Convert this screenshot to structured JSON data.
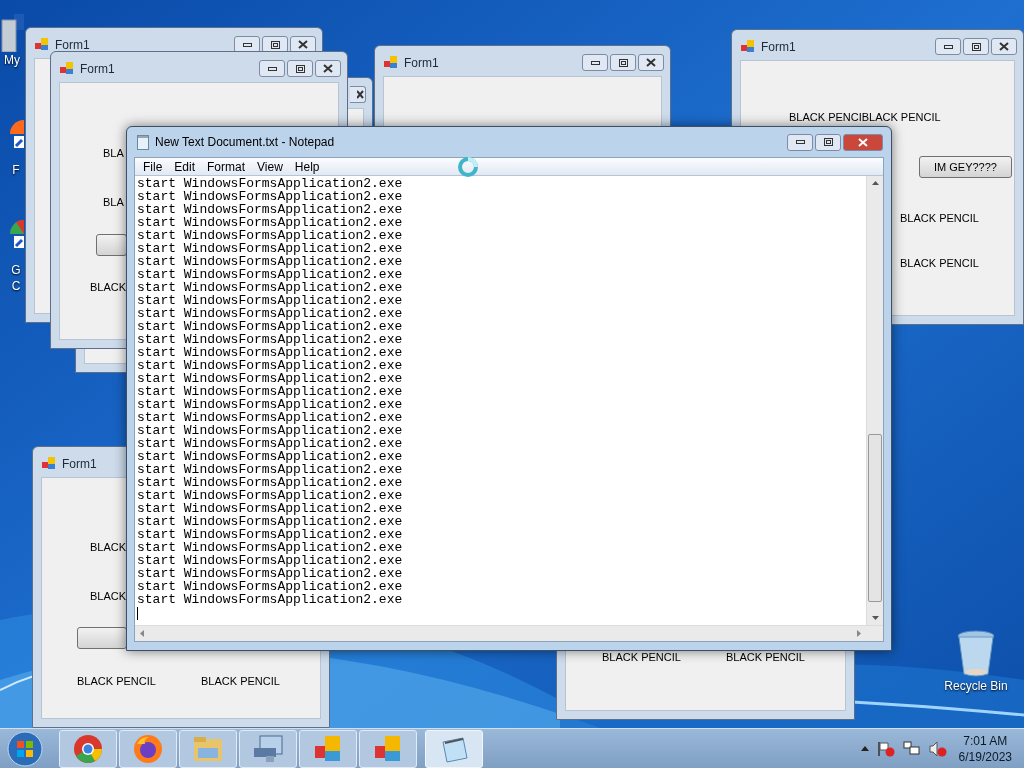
{
  "desktop_icons": [
    {
      "kind": "computer",
      "label": "My"
    },
    {
      "kind": "firefox",
      "label": "F"
    },
    {
      "kind": "chrome",
      "label": "G C"
    },
    {
      "kind": "recycle",
      "label": "Recycle Bin"
    }
  ],
  "forms": [
    {
      "title": "Form1"
    },
    {
      "kind": "behind"
    },
    {
      "title": "Form1",
      "controls": [
        {
          "kind": "label",
          "text": "BLA"
        },
        {
          "kind": "label",
          "text": "BLA"
        },
        {
          "kind": "button"
        },
        {
          "kind": "label",
          "text": "BLACK"
        }
      ]
    },
    {
      "title": "Form1"
    },
    {
      "title": "Form1",
      "controls": [
        {
          "kind": "label",
          "text": "BLACK PENCIBLACK PENCIL"
        },
        {
          "kind": "button",
          "text": "IM GEY????"
        },
        {
          "kind": "label",
          "text": "BLACK PENCIL"
        },
        {
          "kind": "label",
          "text": "BLACK PENCIL"
        }
      ]
    },
    {
      "title": "Form1",
      "controls": [
        {
          "kind": "label",
          "text": "BLACK"
        },
        {
          "kind": "label",
          "text": "BLACK"
        },
        {
          "kind": "button"
        },
        {
          "kind": "label",
          "text": "BLACK PENCIL"
        },
        {
          "kind": "label",
          "text": "BLACK PENCIL"
        }
      ]
    },
    {
      "controls": [
        {
          "kind": "label",
          "text": "BLACK PENCIL"
        },
        {
          "kind": "label",
          "text": "BLACK PENCIL"
        }
      ]
    }
  ],
  "notepad": {
    "title": "New Text Document.txt - Notepad",
    "menu": [
      "File",
      "Edit",
      "Format",
      "View",
      "Help"
    ],
    "lines": [
      "start WindowsFormsApplication2.exe",
      "start WindowsFormsApplication2.exe",
      "start WindowsFormsApplication2.exe",
      "start WindowsFormsApplication2.exe",
      "start WindowsFormsApplication2.exe",
      "start WindowsFormsApplication2.exe",
      "start WindowsFormsApplication2.exe",
      "start WindowsFormsApplication2.exe",
      "start WindowsFormsApplication2.exe",
      "start WindowsFormsApplication2.exe",
      "start WindowsFormsApplication2.exe",
      "start WindowsFormsApplication2.exe",
      "start WindowsFormsApplication2.exe",
      "start WindowsFormsApplication2.exe",
      "start WindowsFormsApplication2.exe",
      "start WindowsFormsApplication2.exe",
      "start WindowsFormsApplication2.exe",
      "start WindowsFormsApplication2.exe",
      "start WindowsFormsApplication2.exe",
      "start WindowsFormsApplication2.exe",
      "start WindowsFormsApplication2.exe",
      "start WindowsFormsApplication2.exe",
      "start WindowsFormsApplication2.exe",
      "start WindowsFormsApplication2.exe",
      "start WindowsFormsApplication2.exe",
      "start WindowsFormsApplication2.exe",
      "start WindowsFormsApplication2.exe",
      "start WindowsFormsApplication2.exe",
      "start WindowsFormsApplication2.exe",
      "start WindowsFormsApplication2.exe",
      "start WindowsFormsApplication2.exe",
      "start WindowsFormsApplication2.exe",
      "start WindowsFormsApplication2.exe"
    ]
  },
  "taskbar": {
    "buttons": [
      {
        "kind": "chrome",
        "active": false
      },
      {
        "kind": "firefox",
        "active": false
      },
      {
        "kind": "explorer",
        "active": false
      },
      {
        "kind": "computer",
        "active": false
      },
      {
        "kind": "form",
        "active": false
      },
      {
        "kind": "form",
        "active": false
      },
      {
        "kind": "notepad",
        "active": true
      }
    ],
    "clock": {
      "time": "7:01 AM",
      "date": "6/19/2023"
    }
  }
}
